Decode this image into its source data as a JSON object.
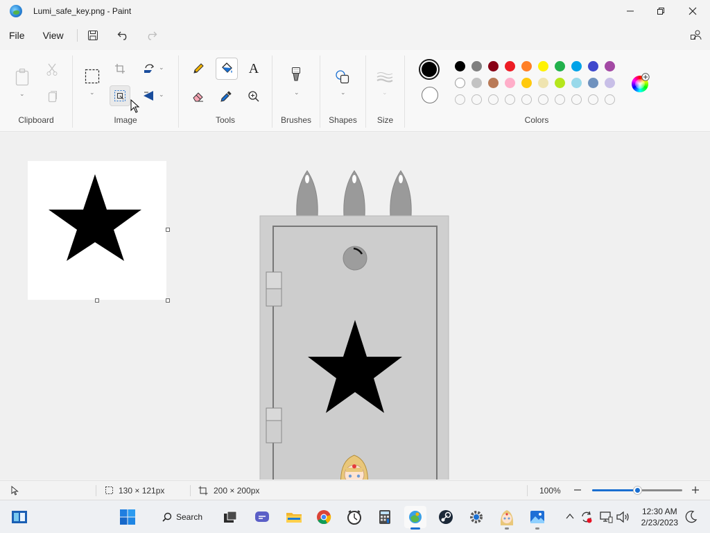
{
  "window": {
    "title": "Lumi_safe_key.png - Paint",
    "controls": {
      "minimize": "—",
      "maximize": "❐",
      "close": "✕"
    }
  },
  "menu": {
    "file": "File",
    "view": "View"
  },
  "ribbon": {
    "groups": {
      "clipboard": "Clipboard",
      "image": "Image",
      "tools": "Tools",
      "brushes": "Brushes",
      "shapes": "Shapes",
      "size": "Size",
      "colors": "Colors"
    },
    "text_tool": "A",
    "palette": {
      "primary": "#000000",
      "secondary": "#ffffff",
      "row1": [
        "#000000",
        "#7f7f7f",
        "#880015",
        "#ed1c24",
        "#ff7f27",
        "#fff200",
        "#22b14c",
        "#00a2e8",
        "#3f48cc",
        "#a349a4"
      ],
      "row2": [
        "#ffffff",
        "#c3c3c3",
        "#b97a57",
        "#ffaec9",
        "#ffc90e",
        "#efe4b0",
        "#b5e61d",
        "#99d9ea",
        "#7092be",
        "#c8bfe7"
      ]
    }
  },
  "canvas": {
    "background": "#ffffff",
    "fill": "#000000"
  },
  "status": {
    "selection_size": "130 × 121px",
    "canvas_size": "200 × 200px",
    "zoom": "100%",
    "zoom_level": 0.5
  },
  "taskbar": {
    "search_label": "Search",
    "time": "12:30 AM",
    "date": "2/23/2023"
  }
}
